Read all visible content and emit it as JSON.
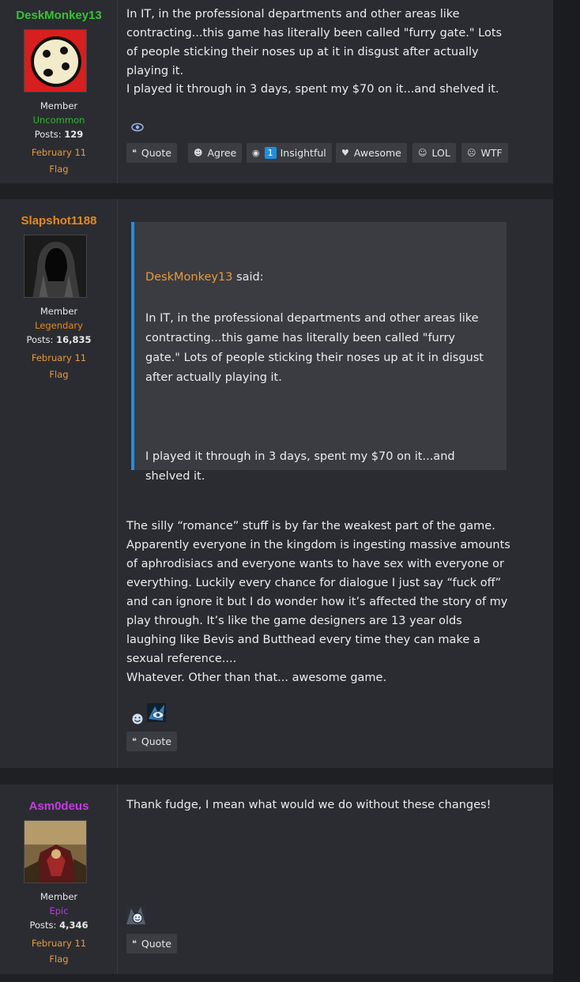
{
  "posts": [
    {
      "username": "DeskMonkey13",
      "username_color": "#35c435",
      "role": "Member",
      "rank": "Uncommon",
      "posts_label": "Posts:",
      "posts_count": "129",
      "date": "February 11",
      "flag": "Flag",
      "body_1": "In IT, in the professional departments and other areas like contracting...this game has literally been called \"furry gate.\" Lots of people sticking their noses up at it in disgust after actually playing it.",
      "body_2": "I played it through in 3 days, spent my $70 on it...and shelved it.",
      "reactions": {
        "quote": "Quote",
        "agree": "Agree",
        "insightful_count": "1",
        "insightful": "Insightful",
        "awesome": "Awesome",
        "lol": "LOL",
        "wtf": "WTF"
      }
    },
    {
      "username": "Slapshot1188",
      "username_color": "#e58a1e",
      "role": "Member",
      "rank": "Legendary",
      "posts_label": "Posts:",
      "posts_count": "16,835",
      "date": "February 11",
      "flag": "Flag",
      "quote_author": "DeskMonkey13",
      "quote_said": "said:",
      "quote_text_1": "In IT, in the professional departments and other areas like contracting...this game has literally been called \"furry gate.\" Lots of people sticking their noses up at it in disgust after actually playing it.",
      "quote_text_2": "I played it through in 3 days, spent my $70 on it...and shelved it.",
      "body_1": "The silly “romance” stuff is by far the weakest part of the game. Apparently everyone in the kingdom is ingesting massive amounts of aphrodisiacs and everyone wants to have sex with everyone or everything. Luckily every chance for dialogue I just say “fuck off” and can ignore it but I do wonder how it’s affected the story of my play through. It’s like the game designers are 13 year olds laughing like Bevis and Butthead every time they can make a sexual reference....",
      "body_2": "Whatever. Other than that... awesome game.",
      "quote_button": "Quote"
    },
    {
      "username": "Asm0deus",
      "username_color": "#c13fe0",
      "role": "Member",
      "rank": "Epic",
      "posts_label": "Posts:",
      "posts_count": "4,346",
      "date": "February 11",
      "flag": "Flag",
      "body_1": "Thank fudge, I mean what would we do without these changes!",
      "quote_button": "Quote"
    }
  ],
  "icons": {
    "quote": "quote-icon",
    "agree": "agree-icon",
    "insightful": "insightful-icon",
    "awesome": "heart-icon",
    "lol": "lol-icon",
    "wtf": "wtf-icon",
    "eye": "eye-icon"
  },
  "colors": {
    "accent_blue": "#1e8fe8",
    "link_orange": "#e89a3c"
  }
}
